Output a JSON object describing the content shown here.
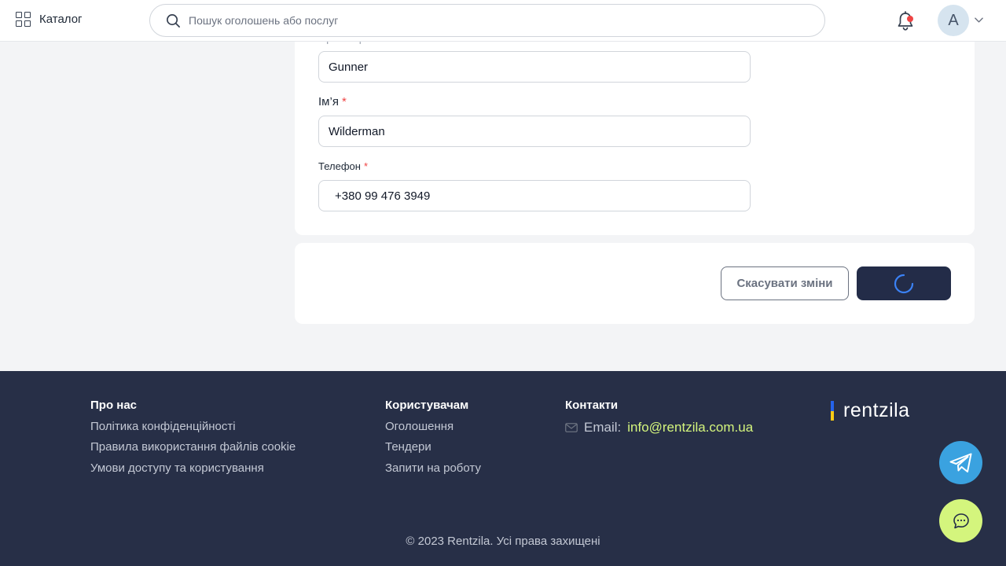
{
  "header": {
    "catalog_label": "Каталог",
    "search_placeholder": "Пошук оголошень або послуг",
    "avatar_initial": "A",
    "notification_dot_color": "#ef4444"
  },
  "form": {
    "fields": [
      {
        "label": "Прізвище",
        "required": true,
        "value": "Gunner"
      },
      {
        "label": "Ім’я",
        "required": true,
        "value": "Wilderman"
      },
      {
        "label": "Телефон",
        "required": true,
        "value": "+380 99 476 3949"
      }
    ],
    "required_mark": "*"
  },
  "actions": {
    "cancel_label": "Скасувати зміни",
    "save_state": "loading"
  },
  "footer": {
    "about": {
      "heading": "Про нас",
      "links": [
        "Політика конфіденційності",
        "Правила використання файлів cookie",
        "Умови доступу та користування"
      ]
    },
    "users": {
      "heading": "Користувачам",
      "links": [
        "Оголошення",
        "Тендери",
        "Запити на роботу"
      ]
    },
    "contacts": {
      "heading": "Контакти",
      "email_label": "Email:",
      "email": "info@rentzila.com.ua"
    },
    "logo_text": "rentzila",
    "copyright": "© 2023 Rentzila. Усі права захищені"
  },
  "colors": {
    "primary_dark": "#232c48",
    "footer_bg": "#272f47",
    "accent_lime": "#d4f57d",
    "telegram_blue": "#3aa2e0",
    "required_red": "#ef4444"
  }
}
